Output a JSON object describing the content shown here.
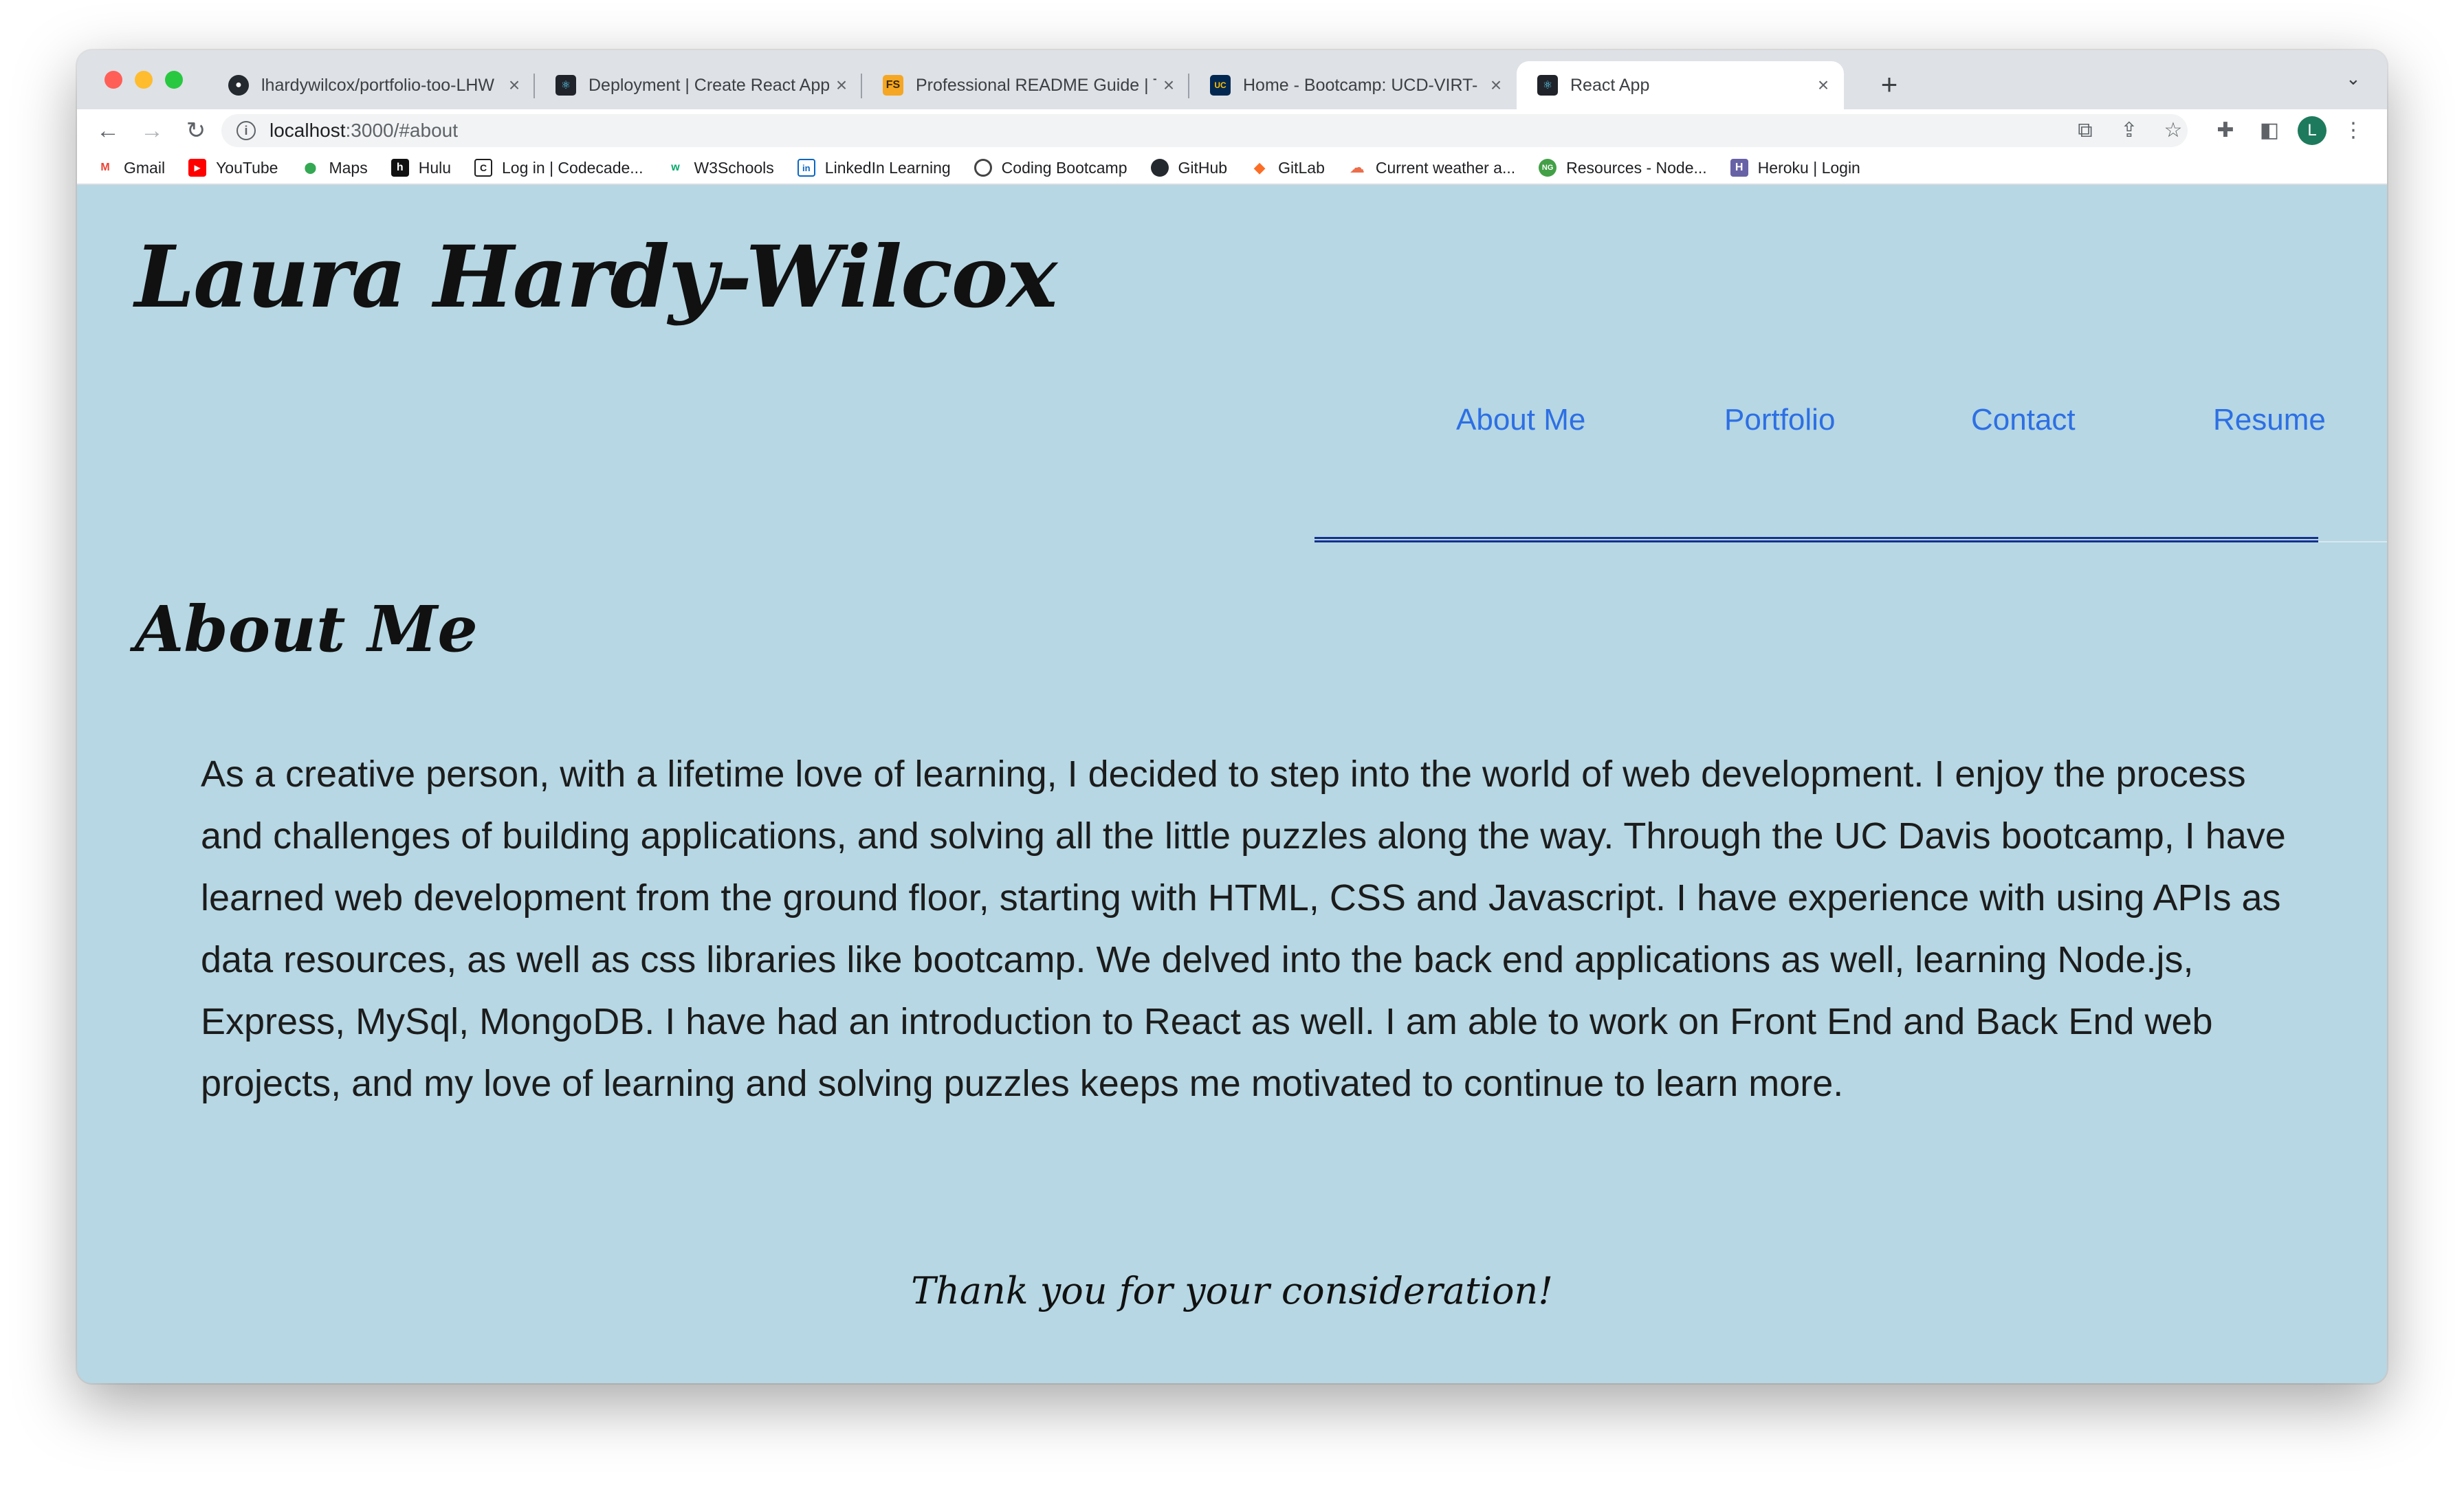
{
  "browser": {
    "tabs": [
      {
        "title": "lhardywilcox/portfolio-too-LHW",
        "favicon": "github-icon",
        "active": false
      },
      {
        "title": "Deployment | Create React App",
        "favicon": "react-icon",
        "active": false
      },
      {
        "title": "Professional README Guide | T",
        "favicon": "fs-icon",
        "active": false
      },
      {
        "title": "Home - Bootcamp: UCD-VIRT-",
        "favicon": "ucd-icon",
        "active": false
      },
      {
        "title": "React App",
        "favicon": "react-icon",
        "active": true
      }
    ],
    "new_tab_label": "+",
    "tab_menu_label": "⌄",
    "address": {
      "host": "localhost",
      "path": ":3000/#about"
    },
    "profile_initial": "L",
    "bookmarks": [
      {
        "label": "Gmail",
        "icon": "gmail-icon"
      },
      {
        "label": "YouTube",
        "icon": "youtube-icon"
      },
      {
        "label": "Maps",
        "icon": "maps-icon"
      },
      {
        "label": "Hulu",
        "icon": "hulu-icon"
      },
      {
        "label": "Log in | Codecade...",
        "icon": "codecademy-icon"
      },
      {
        "label": "W3Schools",
        "icon": "w3schools-icon"
      },
      {
        "label": "LinkedIn Learning",
        "icon": "linkedin-icon"
      },
      {
        "label": "Coding Bootcamp",
        "icon": "bootcamp-icon"
      },
      {
        "label": "GitHub",
        "icon": "github-icon"
      },
      {
        "label": "GitLab",
        "icon": "gitlab-icon"
      },
      {
        "label": "Current weather a...",
        "icon": "weather-icon"
      },
      {
        "label": "Resources - Node...",
        "icon": "node-icon"
      },
      {
        "label": "Heroku | Login",
        "icon": "heroku-icon"
      }
    ]
  },
  "site": {
    "title": "Laura Hardy-Wilcox",
    "nav": [
      {
        "label": "About Me"
      },
      {
        "label": "Portfolio"
      },
      {
        "label": "Contact"
      },
      {
        "label": "Resume"
      }
    ],
    "about": {
      "heading": "About Me",
      "body": "As a creative person, with a lifetime love of learning, I decided to step into the world of web development. I enjoy the process and challenges of building applications, and solving all the little puzzles along the way. Through the UC Davis bootcamp, I have learned web development from the ground floor, starting with HTML, CSS and Javascript. I have experience with using APIs as data resources, as well as css libraries like bootcamp. We delved into the back end applications as well, learning Node.js, Express, MySql, MongoDB. I have had an introduction to React as well. I am able to work on Front End and Back End web projects, and my love of learning and solving puzzles keeps me motivated to continue to learn more."
    },
    "footer": "Thank you for your consideration!"
  },
  "colors": {
    "page_background": "#b6d7e3",
    "nav_link": "#2d6fe4",
    "nav_underline": "#14318f",
    "text": "#1c1c1c"
  }
}
